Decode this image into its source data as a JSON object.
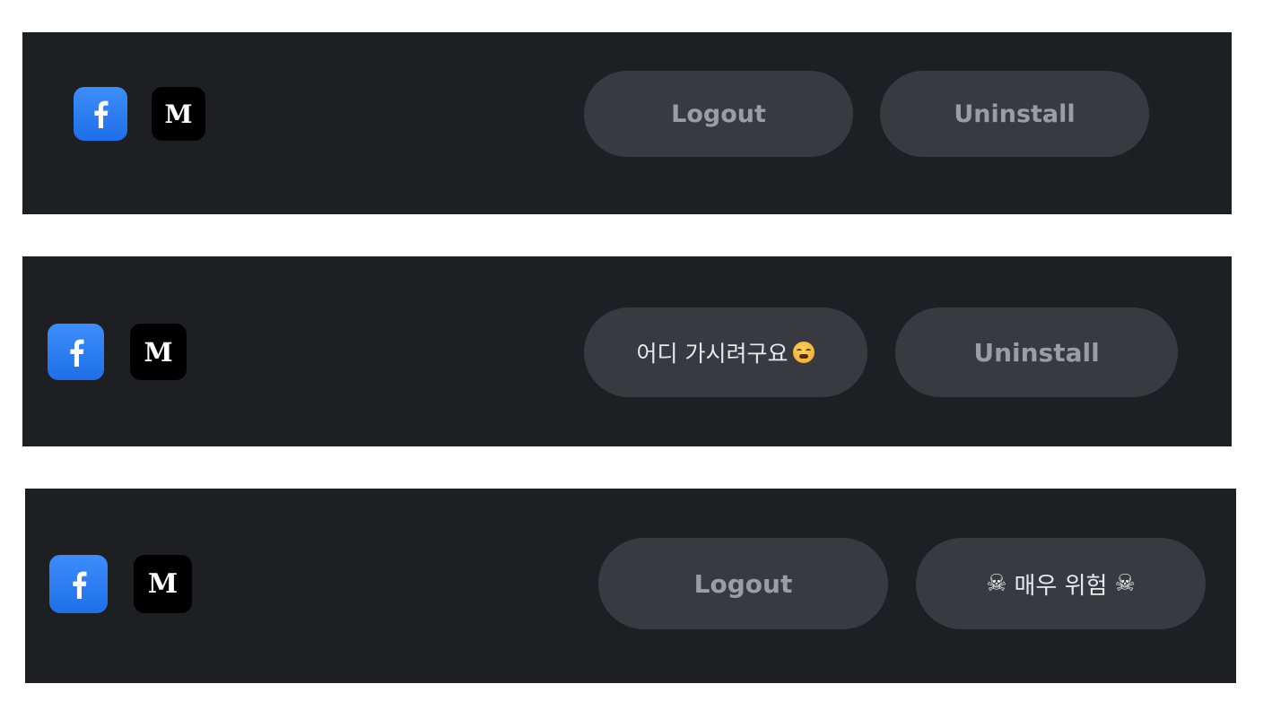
{
  "colors": {
    "panel_bg": "#1e1f23",
    "button_bg": "#393a3f",
    "muted_text": "#9c9ca2",
    "facebook_blue": "#1e6fe8"
  },
  "panels": [
    {
      "icons": [
        {
          "name": "facebook-icon",
          "glyph": "f"
        },
        {
          "name": "medium-icon",
          "glyph": "M"
        }
      ],
      "buttons": [
        {
          "label": "Logout"
        },
        {
          "label": "Uninstall"
        }
      ]
    },
    {
      "icons": [
        {
          "name": "facebook-icon",
          "glyph": "f"
        },
        {
          "name": "medium-icon",
          "glyph": "M"
        }
      ],
      "buttons": [
        {
          "label": "어디 가시려구요",
          "emoji": "weary-face-emoji"
        },
        {
          "label": "Uninstall"
        }
      ]
    },
    {
      "icons": [
        {
          "name": "facebook-icon",
          "glyph": "f"
        },
        {
          "name": "medium-icon",
          "glyph": "M"
        }
      ],
      "buttons": [
        {
          "label": "Logout"
        },
        {
          "label": "매우 위험",
          "emoji": "skull-crossbones-emoji",
          "emoji_glyph": "☠"
        }
      ]
    }
  ]
}
